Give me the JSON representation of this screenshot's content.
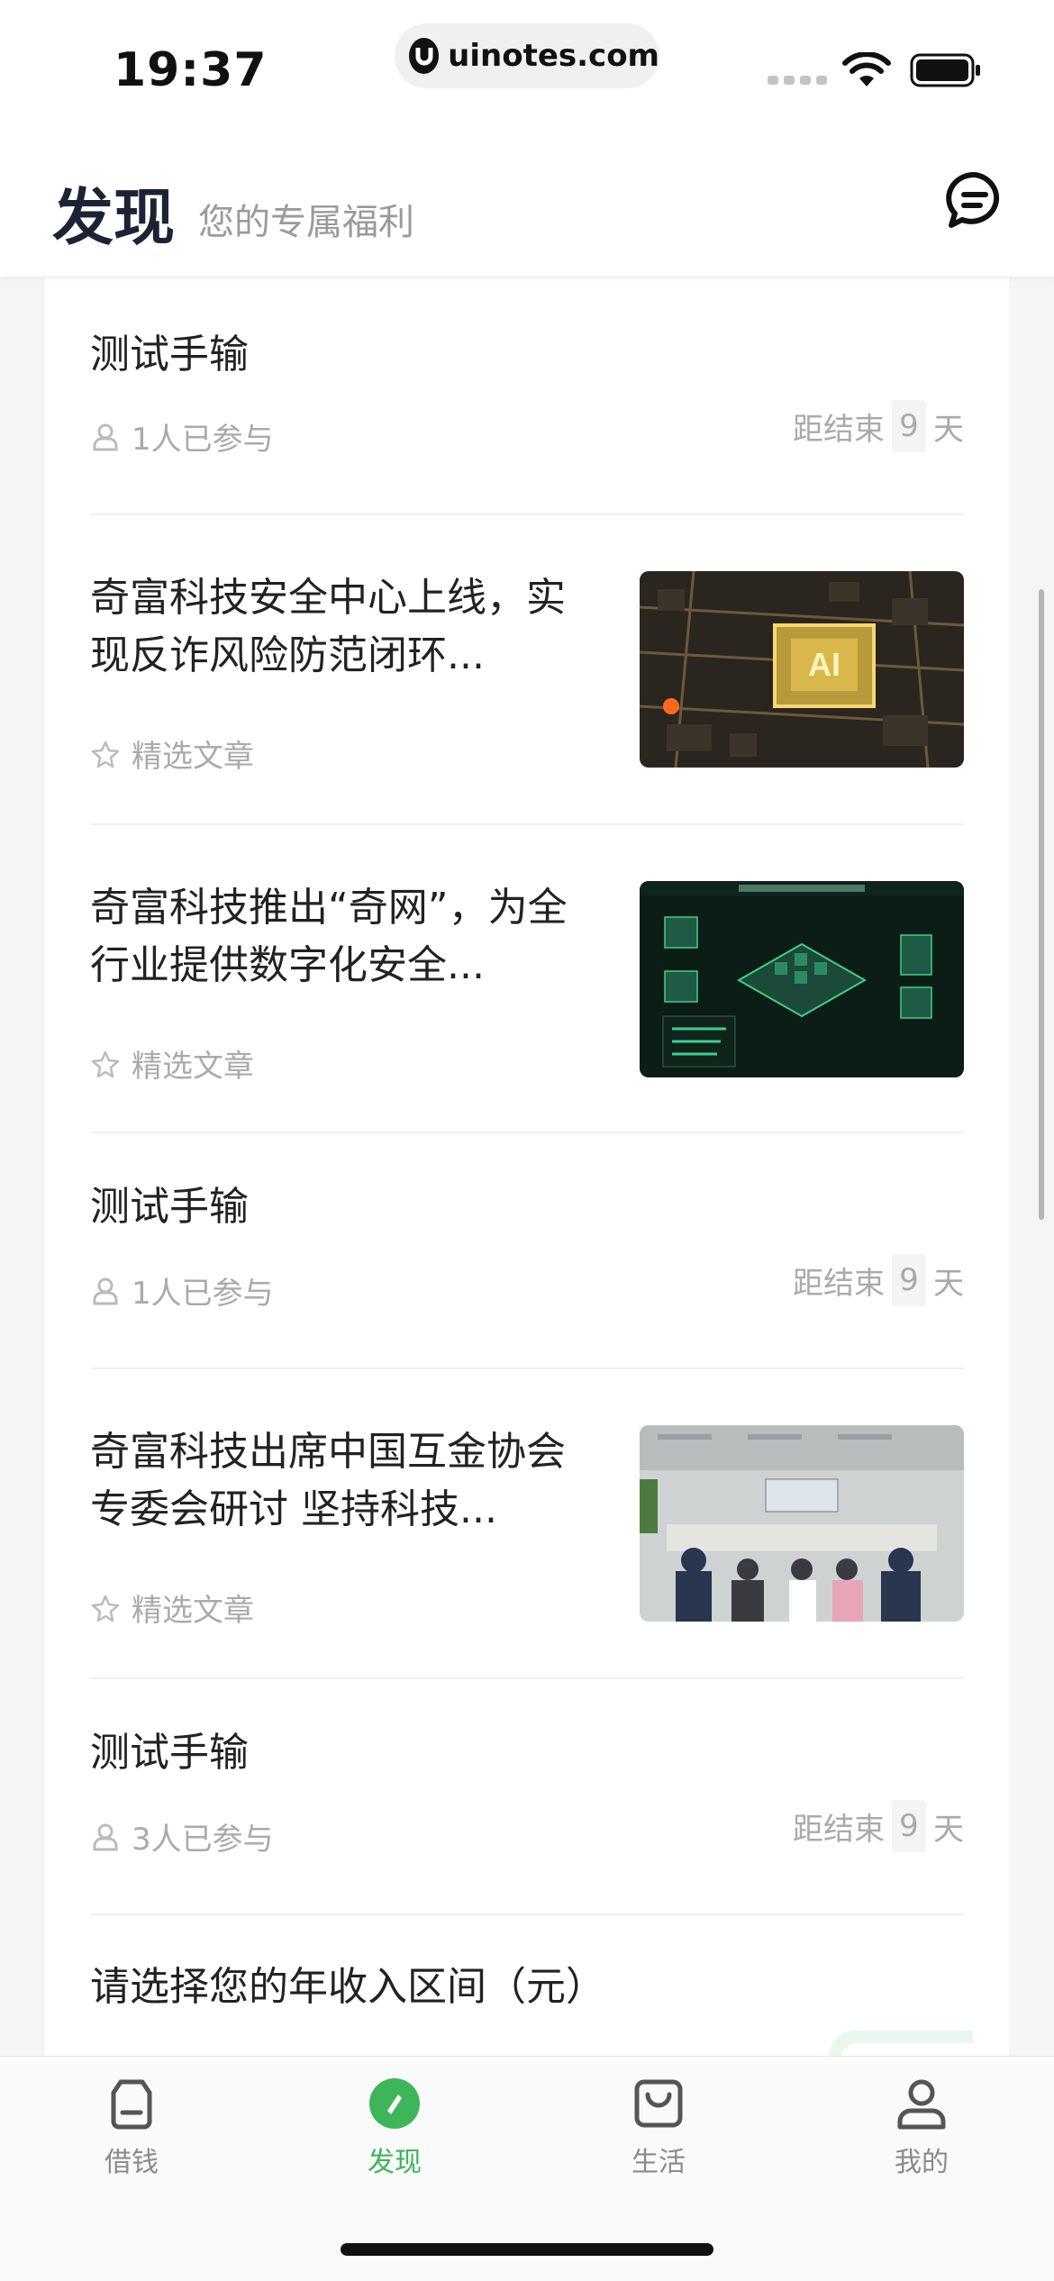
{
  "status_bar": {
    "time": "19:37",
    "url": "uinotes.com"
  },
  "header": {
    "title": "发现",
    "subtitle": "您的专属福利"
  },
  "items": [
    {
      "type": "survey",
      "title": "测试手输",
      "participants": "1人已参与",
      "deadline_prefix": "距结束",
      "deadline_days": "9",
      "deadline_suffix": "天"
    },
    {
      "type": "article",
      "title": "奇富科技安全中心上线，实现反诈风险防范闭环...",
      "tag": "精选文章",
      "image": "ai-chip-image"
    },
    {
      "type": "article",
      "title": "奇富科技推出“奇网”，为全行业提供数字化安全...",
      "tag": "精选文章",
      "image": "network-diagram-image"
    },
    {
      "type": "survey",
      "title": "测试手输",
      "participants": "1人已参与",
      "deadline_prefix": "距结束",
      "deadline_days": "9",
      "deadline_suffix": "天"
    },
    {
      "type": "article",
      "title": "奇富科技出席中国互金协会专委会研讨 坚持科技...",
      "tag": "精选文章",
      "image": "meeting-photo-image"
    },
    {
      "type": "survey",
      "title": "测试手输",
      "participants": "3人已参与",
      "deadline_prefix": "距结束",
      "deadline_days": "9",
      "deadline_suffix": "天"
    },
    {
      "type": "question",
      "title": "请选择您的年收入区间（元）"
    }
  ],
  "tabbar": {
    "tabs": [
      {
        "label": "借钱",
        "icon": "wallet-icon"
      },
      {
        "label": "发现",
        "icon": "compass-icon"
      },
      {
        "label": "生活",
        "icon": "bag-icon"
      },
      {
        "label": "我的",
        "icon": "user-icon"
      }
    ],
    "active_color": "#3fb55a"
  }
}
